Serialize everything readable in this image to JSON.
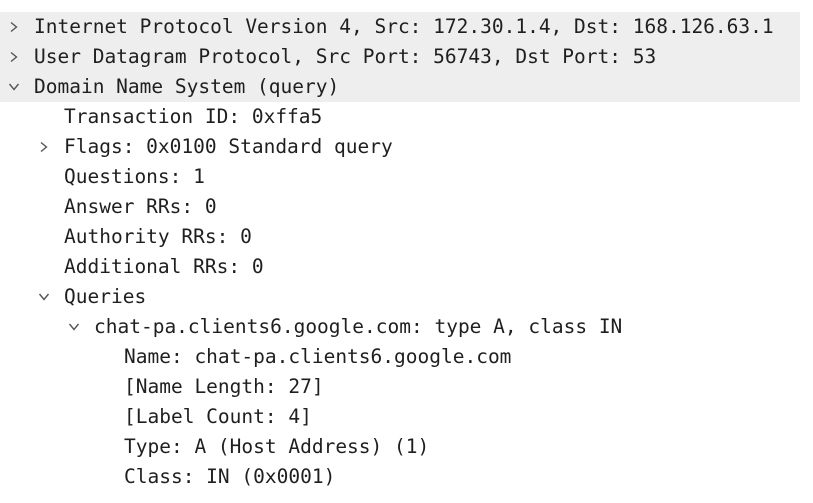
{
  "tree": {
    "rows": [
      {
        "text": "Internet Protocol Version 4, Src: 172.30.1.4, Dst: 168.126.63.1",
        "state": "collapsed",
        "level": 0
      },
      {
        "text": "User Datagram Protocol, Src Port: 56743, Dst Port: 53",
        "state": "collapsed",
        "level": 0
      },
      {
        "text": "Domain Name System (query)",
        "state": "expanded",
        "level": 0
      },
      {
        "text": "Transaction ID: 0xffa5",
        "state": "leaf",
        "level": 1
      },
      {
        "text": "Flags: 0x0100 Standard query",
        "state": "collapsed",
        "level": 1
      },
      {
        "text": "Questions: 1",
        "state": "leaf",
        "level": 1
      },
      {
        "text": "Answer RRs: 0",
        "state": "leaf",
        "level": 1
      },
      {
        "text": "Authority RRs: 0",
        "state": "leaf",
        "level": 1
      },
      {
        "text": "Additional RRs: 0",
        "state": "leaf",
        "level": 1
      },
      {
        "text": "Queries",
        "state": "expanded",
        "level": 1
      },
      {
        "text": "chat-pa.clients6.google.com: type A, class IN",
        "state": "expanded",
        "level": 2
      },
      {
        "text": "Name: chat-pa.clients6.google.com",
        "state": "leaf",
        "level": 3
      },
      {
        "text": "[Name Length: 27]",
        "state": "leaf",
        "level": 3
      },
      {
        "text": "[Label Count: 4]",
        "state": "leaf",
        "level": 3
      },
      {
        "text": "Type: A (Host Address) (1)",
        "state": "leaf",
        "level": 3
      },
      {
        "text": "Class: IN (0x0001)",
        "state": "leaf",
        "level": 3
      }
    ]
  },
  "icons": {
    "collapsed": "chevron-right-icon",
    "expanded": "chevron-down-icon"
  },
  "colors": {
    "text": "#1f1f1f",
    "highlight": "#eeeeee",
    "arrow": "#555555"
  }
}
